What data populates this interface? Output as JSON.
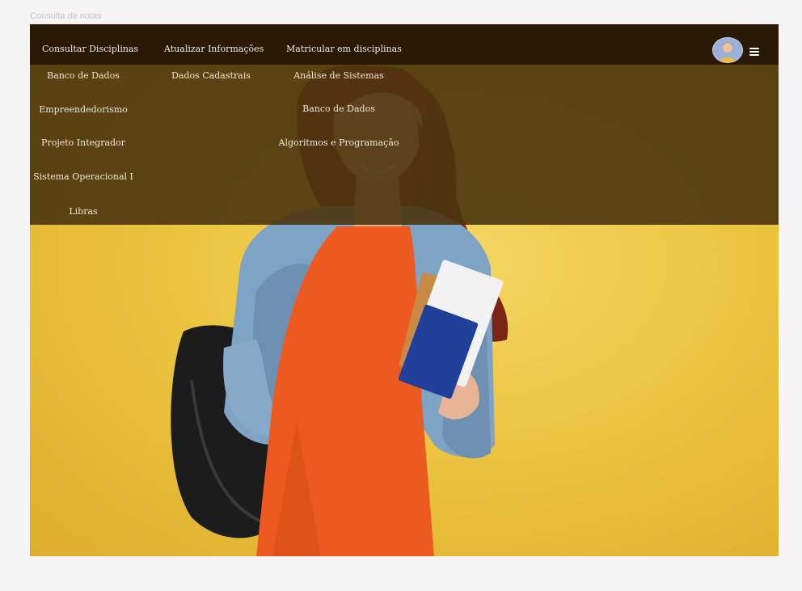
{
  "page": {
    "label": "Consulta de notas"
  },
  "nav": {
    "items": [
      {
        "label": "Consultar Disciplinas"
      },
      {
        "label": "Atualizar Informações"
      },
      {
        "label": "Matricular em disciplinas"
      }
    ]
  },
  "menus": {
    "consultar": [
      "Banco de Dados",
      "Empreendedorismo",
      "Projeto Integrador",
      "Sistema Operacional I",
      "Libras"
    ],
    "atualizar": [
      "Dados Cadastrais"
    ],
    "matricular": [
      "Análise de Sistemas",
      "Banco de Dados",
      "Algoritmos e Programação"
    ]
  },
  "icons": {
    "user": "avatar-icon",
    "menu": "hamburger-icon"
  },
  "colors": {
    "topbar": "#2a1905",
    "dropdown": "#4a340e",
    "hero_background": "#ecc440",
    "nav_text": "#f1ece2"
  }
}
